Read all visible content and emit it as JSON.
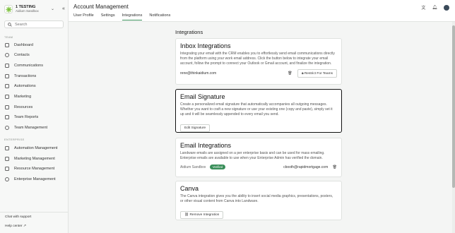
{
  "org": {
    "name": "1 TESTING",
    "subtitle": "Aidium Sandbox"
  },
  "search": {
    "placeholder": "Search"
  },
  "sidebar": {
    "team_label": "TEAM",
    "team_items": [
      "Dashboard",
      "Contacts",
      "Communications",
      "Transactions",
      "Automations",
      "Marketing",
      "Resources",
      "Team Reports",
      "Team Management"
    ],
    "enterprise_label": "ENTERPRISE",
    "enterprise_items": [
      "Automation Management",
      "Marketing Management",
      "Resource Management",
      "Enterprise Management"
    ],
    "chat_support": "Chat with support",
    "help_center": "Help center"
  },
  "header": {
    "title": "Account Management",
    "tabs": [
      "User Profile",
      "Settings",
      "Integrations",
      "Notifications"
    ],
    "active_tab": "Integrations"
  },
  "main": {
    "heading": "Integrations",
    "inbox": {
      "title": "Inbox Integrations",
      "description": "Integrating your email with the CRM enables you to effortlessly send email communications directly from the platform using your work email address. Click the button below to integrate your email account, follow the prompt to connect your Outlook or Gmail account, and finalize the integration.",
      "email": "rene@thinkaidium.com",
      "restrict_button": "Restrict For Teams"
    },
    "signature": {
      "title": "Email Signature",
      "description": "Create a personalized email signature that automatically accompanies all outgoing messages. Whether you want to craft a new signature or use your existing one (copy and paste), simply set it up and it will be seamlessly appended to every email you send.",
      "button": "Edit Signature"
    },
    "email_integrations": {
      "title": "Email Integrations",
      "description": "Landware emails are assigned on a per enterprise basis and can be used for mass emailing. Enterprise emails are available to use when your Enterprise Admin has verified the domain.",
      "org": "Aidium Sandbox",
      "badge": "Verified",
      "email": "cbooth@rapidmortgage.com"
    },
    "canva": {
      "title": "Canva",
      "description": "The Canva integration gives you the ability to insert social media graphics, presentations, posters, or other visual content from Canva into Landware.",
      "button": "Remove Integration"
    }
  },
  "colors": {
    "accent": "#3a8f5a",
    "highlight_border": "#111111"
  }
}
